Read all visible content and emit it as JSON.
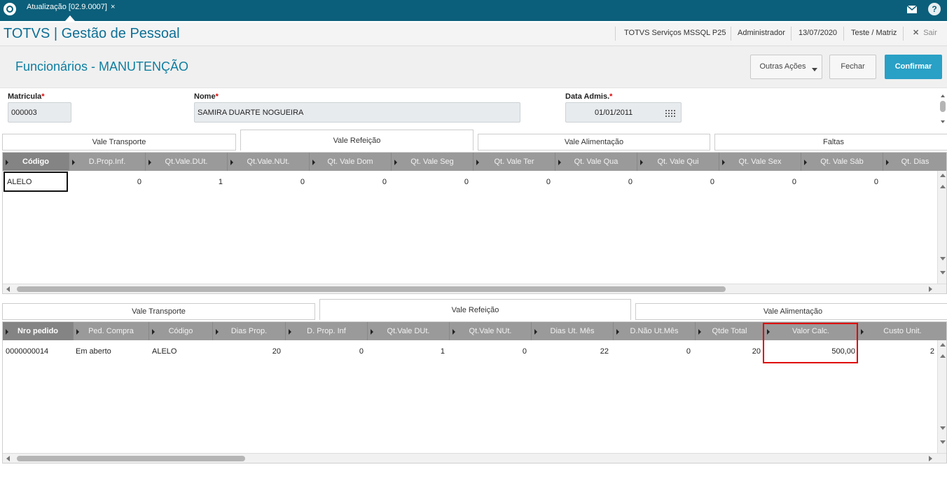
{
  "topbar": {
    "tab_title": "Atualização [02.9.0007]",
    "close_glyph": "×",
    "mail_icon": "mail-icon",
    "help_glyph": "?"
  },
  "header": {
    "app_title": "TOTVS | Gestão de Pessoal",
    "environment": "TOTVS Serviços MSSQL P25",
    "user": "Administrador",
    "date": "13/07/2020",
    "branch": "Teste / Matriz",
    "exit_label": "Sair"
  },
  "page": {
    "title": "Funcionários - MANUTENÇÃO",
    "actions": {
      "other_label": "Outras Ações",
      "close_label": "Fechar",
      "confirm_label": "Confirmar"
    }
  },
  "form": {
    "matricula": {
      "label": "Matricula",
      "required": "*",
      "value": "000003"
    },
    "nome": {
      "label": "Nome",
      "required": "*",
      "value": "SAMIRA DUARTE NOGUEIRA"
    },
    "data_admis": {
      "label": "Data Admis.",
      "required": "*",
      "value": "01/01/2011"
    }
  },
  "upper_tabs": [
    "Vale Transporte",
    "Vale Refeição",
    "Vale Alimentação",
    "Faltas"
  ],
  "upper_grid": {
    "columns": [
      "Código",
      "D.Prop.Inf.",
      "Qt.Vale.DUt.",
      "Qt.Vale.NUt.",
      "Qt. Vale Dom",
      "Qt. Vale Seg",
      "Qt. Vale Ter",
      "Qt. Vale Qua",
      "Qt. Vale Qui",
      "Qt. Vale Sex",
      "Qt. Vale Sáb",
      "Qt. Dias"
    ],
    "rows": [
      [
        "ALELO",
        "0",
        "1",
        "0",
        "0",
        "0",
        "0",
        "0",
        "0",
        "0",
        "0"
      ]
    ]
  },
  "lower_tabs": [
    "Vale Transporte",
    "Vale Refeição",
    "Vale Alimentação"
  ],
  "lower_grid": {
    "columns": [
      "Nro pedido",
      "Ped. Compra",
      "Código",
      "Dias Prop.",
      "D. Prop. Inf",
      "Qt.Vale DUt.",
      "Qt.Vale NUt.",
      "Dias Ut. Mês",
      "D.Não Ut.Mês",
      "Qtde Total",
      "Valor Calc.",
      "Custo Unit."
    ],
    "rows": [
      [
        "0000000014",
        "Em aberto",
        "ALELO",
        "20",
        "0",
        "1",
        "0",
        "22",
        "0",
        "20",
        "500,00",
        "2"
      ]
    ]
  }
}
